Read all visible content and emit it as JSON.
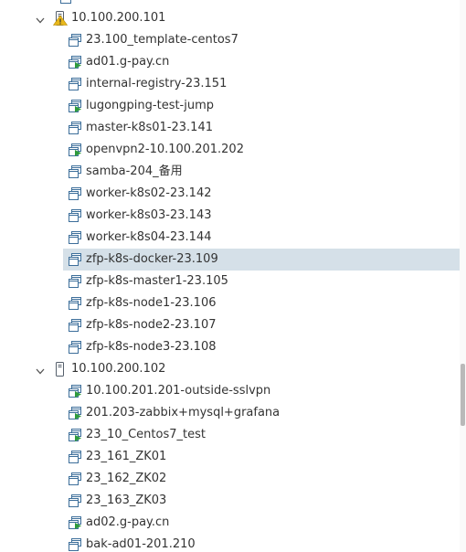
{
  "colors": {
    "selection": "#d5e0e8",
    "vm_icon_stroke": "#3c6e9a",
    "power_on": "#2e9a3c",
    "warning": "#e8b71a",
    "text": "#333333"
  },
  "clipped_top_label": "...",
  "hosts": [
    {
      "name": "10.100.200.101",
      "icon": "host-warning-icon",
      "expanded": true,
      "vms": [
        {
          "name": "23.100_template-centos7",
          "icon": "vm-template-icon",
          "powered_on": false
        },
        {
          "name": "ad01.g-pay.cn",
          "icon": "vm-powered-on-icon",
          "powered_on": true
        },
        {
          "name": "internal-registry-23.151",
          "icon": "vm-powered-off-icon",
          "powered_on": false
        },
        {
          "name": "lugongping-test-jump",
          "icon": "vm-powered-on-icon",
          "powered_on": true
        },
        {
          "name": "master-k8s01-23.141",
          "icon": "vm-powered-off-icon",
          "powered_on": false
        },
        {
          "name": "openvpn2-10.100.201.202",
          "icon": "vm-powered-on-icon",
          "powered_on": true
        },
        {
          "name": "samba-204_备用",
          "icon": "vm-powered-off-icon",
          "powered_on": false
        },
        {
          "name": "worker-k8s02-23.142",
          "icon": "vm-powered-off-icon",
          "powered_on": false
        },
        {
          "name": "worker-k8s03-23.143",
          "icon": "vm-powered-off-icon",
          "powered_on": false
        },
        {
          "name": "worker-k8s04-23.144",
          "icon": "vm-powered-off-icon",
          "powered_on": false
        },
        {
          "name": "zfp-k8s-docker-23.109",
          "icon": "vm-powered-off-icon",
          "powered_on": false,
          "selected": true
        },
        {
          "name": "zfp-k8s-master1-23.105",
          "icon": "vm-powered-off-icon",
          "powered_on": false
        },
        {
          "name": "zfp-k8s-node1-23.106",
          "icon": "vm-powered-off-icon",
          "powered_on": false
        },
        {
          "name": "zfp-k8s-node2-23.107",
          "icon": "vm-powered-off-icon",
          "powered_on": false
        },
        {
          "name": "zfp-k8s-node3-23.108",
          "icon": "vm-powered-off-icon",
          "powered_on": false
        }
      ]
    },
    {
      "name": "10.100.200.102",
      "icon": "host-icon",
      "expanded": true,
      "vms": [
        {
          "name": "10.100.201.201-outside-sslvpn",
          "icon": "vm-powered-on-icon",
          "powered_on": true
        },
        {
          "name": "201.203-zabbix+mysql+grafana",
          "icon": "vm-powered-on-icon",
          "powered_on": true
        },
        {
          "name": "23_10_Centos7_test",
          "icon": "vm-powered-on-icon",
          "powered_on": true
        },
        {
          "name": "23_161_ZK01",
          "icon": "vm-powered-off-icon",
          "powered_on": false
        },
        {
          "name": "23_162_ZK02",
          "icon": "vm-powered-off-icon",
          "powered_on": false
        },
        {
          "name": "23_163_ZK03",
          "icon": "vm-powered-off-icon",
          "powered_on": false
        },
        {
          "name": "ad02.g-pay.cn",
          "icon": "vm-powered-on-icon",
          "powered_on": true
        },
        {
          "name": "bak-ad01-201.210",
          "icon": "vm-powered-off-icon",
          "powered_on": false
        }
      ]
    }
  ]
}
